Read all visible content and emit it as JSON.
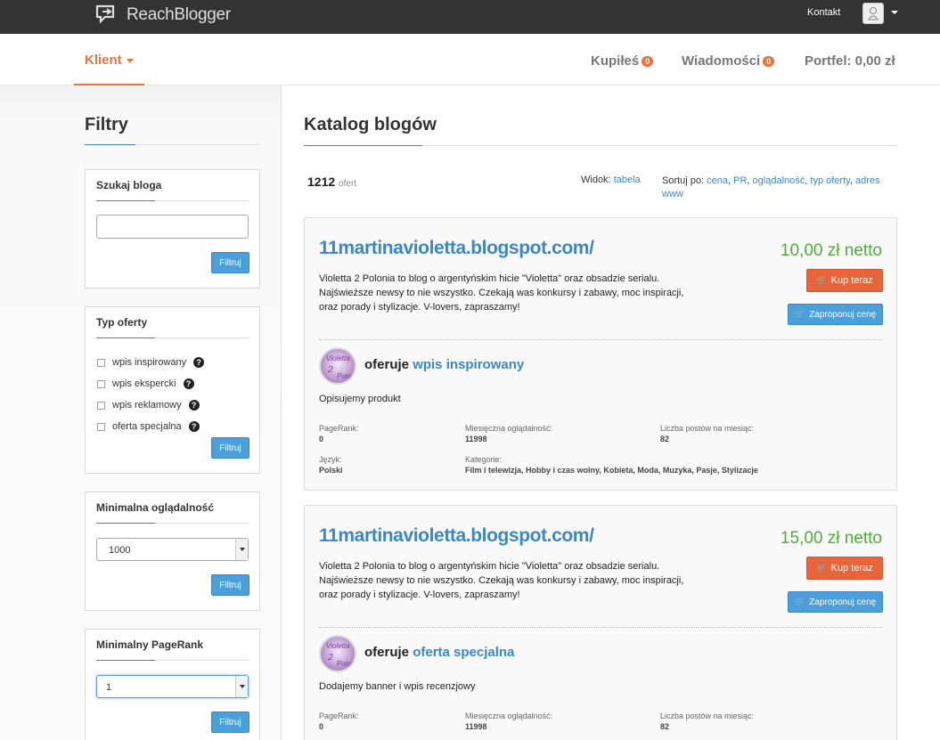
{
  "topbar": {
    "logo_text": "ReachBlogger",
    "contact": "Kontakt"
  },
  "nav": {
    "client_label": "Klient",
    "bought_label": "Kupiłeś",
    "bought_count": "0",
    "messages_label": "Wiadomości",
    "messages_count": "0",
    "wallet_label": "Portfel: 0,00 zł"
  },
  "sidebar": {
    "title": "Filtry",
    "search": {
      "title": "Szukaj bloga",
      "value": "",
      "button": "Filtruj"
    },
    "offer_type": {
      "title": "Typ oferty",
      "options": [
        "wpis inspirowany",
        "wpis ekspercki",
        "wpis reklamowy",
        "oferta specjalna"
      ],
      "button": "Filtruj"
    },
    "min_views": {
      "title": "Minimalna oglądalność",
      "value": "1000",
      "button": "Filtruj"
    },
    "min_pagerank": {
      "title": "Minimalny PageRank",
      "value": "1",
      "button": "Filtruj"
    }
  },
  "main": {
    "title": "Katalog blogów",
    "count": "1212",
    "count_suffix": "ofert",
    "view_label": "Widok:",
    "view_option": "tabela",
    "sort_label": "Sortuj po:",
    "sort_options": [
      "cena",
      "PR",
      "oglądalność",
      "typ oferty",
      "adres www"
    ]
  },
  "offers": [
    {
      "url": "11martinavioletta.blogspot.com/",
      "description": "Violetta 2 Polonia to blog o argentyńskim hicie \"Violetta\" oraz obsadzie serialu. Najświeższe newsy to nie wszystko. Czekają was konkursy i zabawy, moc inspiracji, oraz porady i stylizacje. V-lovers, zapraszamy!",
      "price": "10,00 zł netto",
      "buy_label": "Kup teraz",
      "propose_label": "Zaproponuj cenę",
      "offers_word": "oferuje",
      "offer_type": "wpis inspirowany",
      "note": "Opisujemy produkt",
      "pagerank_label": "PageRank:",
      "pagerank": "0",
      "views_label": "Miesięczna oglądalność:",
      "views": "11998",
      "posts_label": "Liczba postów na miesiąc:",
      "posts": "82",
      "language_label": "Język:",
      "language": "Polski",
      "categories_label": "Kategorie:",
      "categories": "Film i telewizja, Hobby i czas wolny, Kobieta, Moda, Muzyka, Pasje, Stylizacje"
    },
    {
      "url": "11martinavioletta.blogspot.com/",
      "description": "Violetta 2 Polonia to blog o argentyńskim hicie \"Violetta\" oraz obsadzie serialu. Najświeższe newsy to nie wszystko. Czekają was konkursy i zabawy, moc inspiracji, oraz porady i stylizacje. V-lovers, zapraszamy!",
      "price": "15,00 zł netto",
      "buy_label": "Kup teraz",
      "propose_label": "Zaproponuj cenę",
      "offers_word": "oferuje",
      "offer_type": "oferta specjalna",
      "note": "Dodajemy banner i wpis recenzjowy",
      "pagerank_label": "PageRank:",
      "pagerank": "0",
      "views_label": "Miesięczna oglądalność:",
      "views": "11998",
      "posts_label": "Liczba postów na miesiąc:",
      "posts": "82"
    }
  ]
}
